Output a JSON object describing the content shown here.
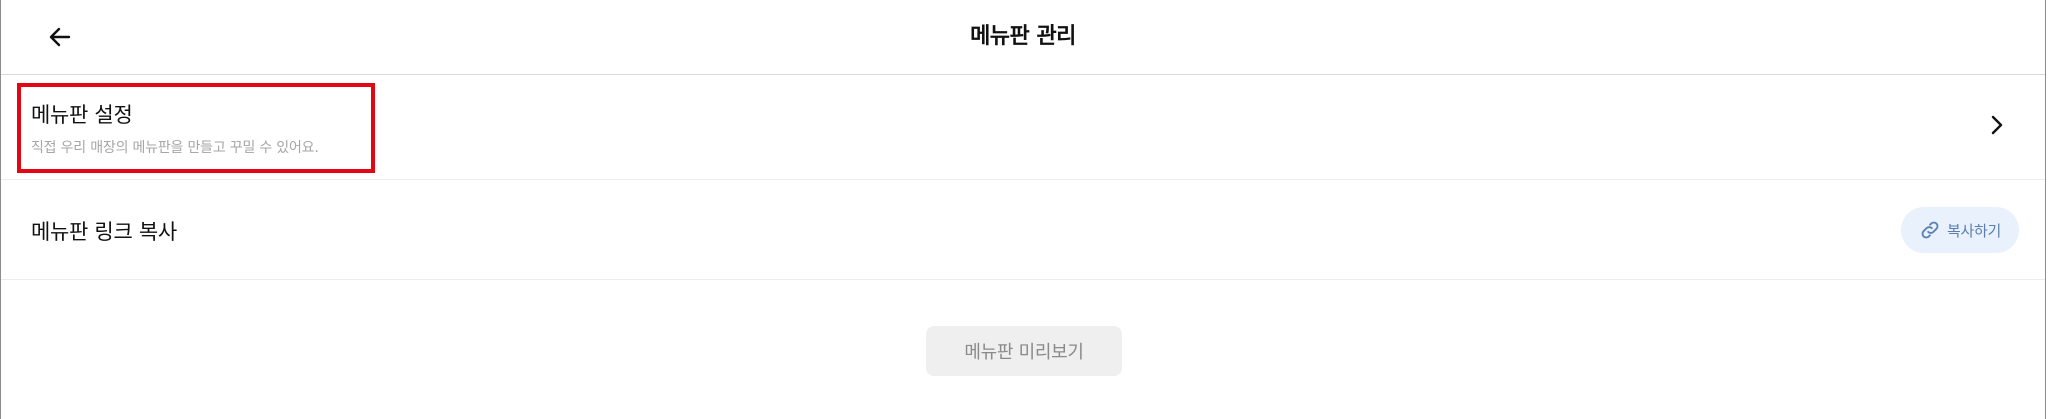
{
  "header": {
    "title": "메뉴판 관리",
    "back_icon": "arrow-left-icon"
  },
  "settings_row": {
    "title": "메뉴판 설정",
    "subtitle": "직접 우리 매장의 메뉴판을 만들고 꾸밀 수 있어요.",
    "chevron_icon": "chevron-right-icon",
    "highlight_color": "#e30613"
  },
  "link_row": {
    "title": "메뉴판 링크 복사",
    "copy_button_label": "복사하기",
    "copy_icon": "link-icon"
  },
  "preview_button": {
    "label": "메뉴판 미리보기"
  },
  "colors": {
    "accent_bg": "#e8f1fc",
    "accent_text": "#5b7fb5",
    "highlight": "#e30613"
  }
}
